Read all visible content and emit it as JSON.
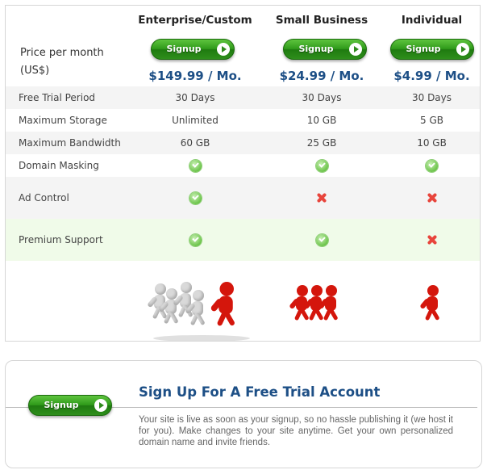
{
  "plans": [
    {
      "name": "Enterprise/Custom",
      "signup_label": "Signup",
      "price": "$149.99 / Mo."
    },
    {
      "name": "Small Business",
      "signup_label": "Signup",
      "price": "$24.99 / Mo."
    },
    {
      "name": "Individual",
      "signup_label": "Signup",
      "price": "$4.99 / Mo."
    }
  ],
  "price_label_line1": "Price per month",
  "price_label_line2": "(US$)",
  "features": [
    {
      "label": "Free Trial Period",
      "values": [
        "30 Days",
        "30 Days",
        "30 Days"
      ]
    },
    {
      "label": "Maximum Storage",
      "values": [
        "Unlimited",
        "10 GB",
        "5 GB"
      ]
    },
    {
      "label": "Maximum Bandwidth",
      "values": [
        "60 GB",
        "25 GB",
        "10 GB"
      ]
    },
    {
      "label": "Domain Masking",
      "values": [
        "yes",
        "yes",
        "yes"
      ]
    },
    {
      "label": "Ad Control",
      "values": [
        "yes",
        "no",
        "no"
      ]
    },
    {
      "label": "Premium Support",
      "values": [
        "yes",
        "yes",
        "no"
      ]
    }
  ],
  "icons": {
    "yes": "check-icon",
    "no": "cross-icon"
  },
  "colors": {
    "accent_blue": "#1d4f86",
    "button_green": "#2f9a1a",
    "check_green": "#6cc44a",
    "cross_red": "#e8453c",
    "highlight_row": "#f0fbe9"
  },
  "trial_panel": {
    "signup_label": "Signup",
    "title": "Sign Up For A Free Trial Account",
    "description": "Your site is live as soon as your signup, so no hassle publishing it (we host it for you). Make changes to your site anytime. Get your own personalized domain name and invite friends."
  }
}
